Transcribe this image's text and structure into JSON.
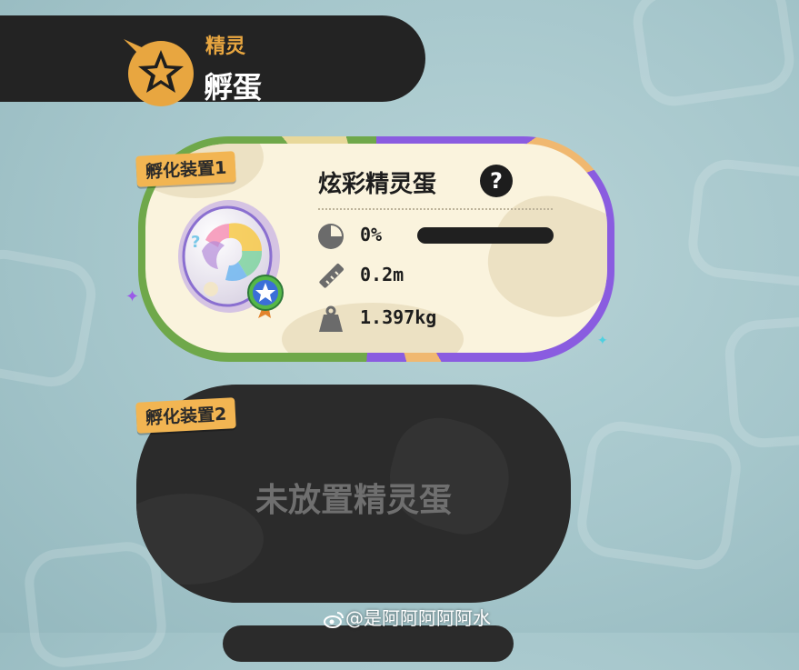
{
  "header": {
    "category": "精灵",
    "title": "孵蛋",
    "badge_icon": "star-speech-bubble-icon"
  },
  "incubators": [
    {
      "tag": "孵化装置1",
      "egg": {
        "name": "炫彩精灵蛋",
        "help_icon": "?",
        "progress_text": "0%",
        "progress_fraction": 0,
        "height_text": "0.2m",
        "weight_text": "1.397kg"
      }
    },
    {
      "tag": "孵化装置2",
      "empty_text": "未放置精灵蛋"
    }
  ],
  "watermark": "@是阿阿阿阿阿水",
  "colors": {
    "header_bg": "#232323",
    "accent_orange": "#f2b552",
    "card_cream": "#faf3dd",
    "border_purple": "#8a5ce0",
    "border_green": "#6fa84a",
    "empty_slot": "#2b2b2b",
    "text_dark": "#1d1d1d"
  }
}
